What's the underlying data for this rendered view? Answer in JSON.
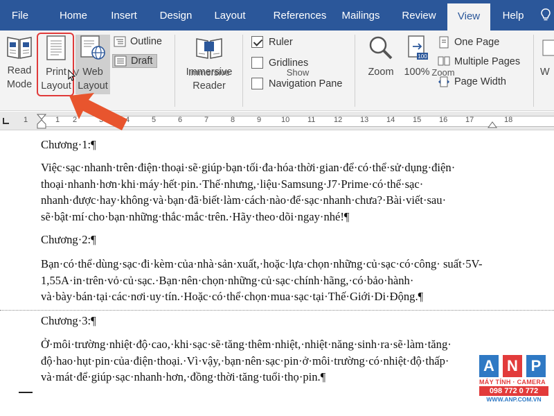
{
  "tabs": [
    {
      "label": "File"
    },
    {
      "label": "Home"
    },
    {
      "label": "Insert"
    },
    {
      "label": "Design"
    },
    {
      "label": "Layout"
    },
    {
      "label": "References"
    },
    {
      "label": "Mailings"
    },
    {
      "label": "Review"
    },
    {
      "label": "View"
    },
    {
      "label": "Help"
    }
  ],
  "ribbon": {
    "views": {
      "read_mode": [
        "Read",
        "Mode"
      ],
      "print_layout": [
        "Print",
        "Layout"
      ],
      "web_layout": [
        "Web",
        "Layout"
      ],
      "outline": "Outline",
      "draft": "Draft",
      "group_label": "V"
    },
    "immersive": {
      "reader": [
        "Immersive",
        "Reader"
      ],
      "group_label": "Immersive"
    },
    "show": {
      "ruler": "Ruler",
      "gridlines": "Gridlines",
      "navigation_pane": "Navigation Pane",
      "ruler_checked": true,
      "gridlines_checked": false,
      "navigation_checked": false,
      "group_label": "Show"
    },
    "zoom": {
      "zoom": "Zoom",
      "hundred": "100%",
      "badge": "100",
      "one_page": "One Page",
      "multiple_pages": "Multiple Pages",
      "page_width": "Page Width",
      "group_label": "Zoom"
    },
    "cut_off_label": "W"
  },
  "ruler_numbers": [
    "1",
    "1",
    "2",
    "3",
    "4",
    "5",
    "6",
    "7",
    "8",
    "9",
    "10",
    "11",
    "12",
    "13",
    "14",
    "15",
    "16",
    "17",
    "18"
  ],
  "document": {
    "paragraphs": [
      "Chương·1:¶",
      "Việc·sạc·nhanh·trên·điện·thoại·sẽ·giúp·bạn·tối·đa·hóa·thời·gian·để·có·thể·sử·dụng·điện· thoại·nhanh·hơn·khi·máy·hết·pin.·Thế·nhưng,·liệu·Samsung·J7·Prime·có·thể·sạc· nhanh·được·hay·không·và·bạn·đã·biết·làm·cách·nào·để·sạc·nhanh·chưa?·Bài·viết·sau· sẽ·bật·mí·cho·bạn·những·thắc·mắc·trên.·Hãy·theo·dõi·ngay·nhé!¶",
      "Chương·2:¶",
      "Bạn·có·thể·dùng·sạc·đi·kèm·của·nhà·sản·xuất,·hoặc·lựa·chọn·những·củ·sạc·có·công· suất·5V-1,55A·in·trên·vỏ·củ·sạc.·Bạn·nên·chọn·những·củ·sạc·chính·hãng,·có·bảo·hành· và·bày·bán·tại·các·nơi·uy·tín.·Hoặc·có·thể·chọn·mua·sạc·tại·Thế·Giới·Di·Động.¶",
      "Chương·3:¶",
      "Ở·môi·trường·nhiệt·độ·cao,·khi·sạc·sẽ·tăng·thêm·nhiệt,·nhiệt·năng·sinh·ra·sẽ·làm·tăng· độ·hao·hụt·pin·của·điện·thoại.·Vì·vậy,·bạn·nên·sạc·pin·ở·môi·trường·có·nhiệt·độ·thấp· và·mát·để·giúp·sạc·nhanh·hơn,·đồng·thời·tăng·tuổi·thọ·pin.¶"
    ]
  },
  "watermark": {
    "letters": [
      "A",
      "N",
      "P"
    ],
    "tagline": "MÁY TÍNH · CAMERA",
    "phone": "098 772 0 772",
    "url": "WWW.ANP.COM.VN"
  },
  "colors": {
    "tab_bar": "#2b579a",
    "highlight": "#e03a3a",
    "arrow": "#e8552e"
  }
}
